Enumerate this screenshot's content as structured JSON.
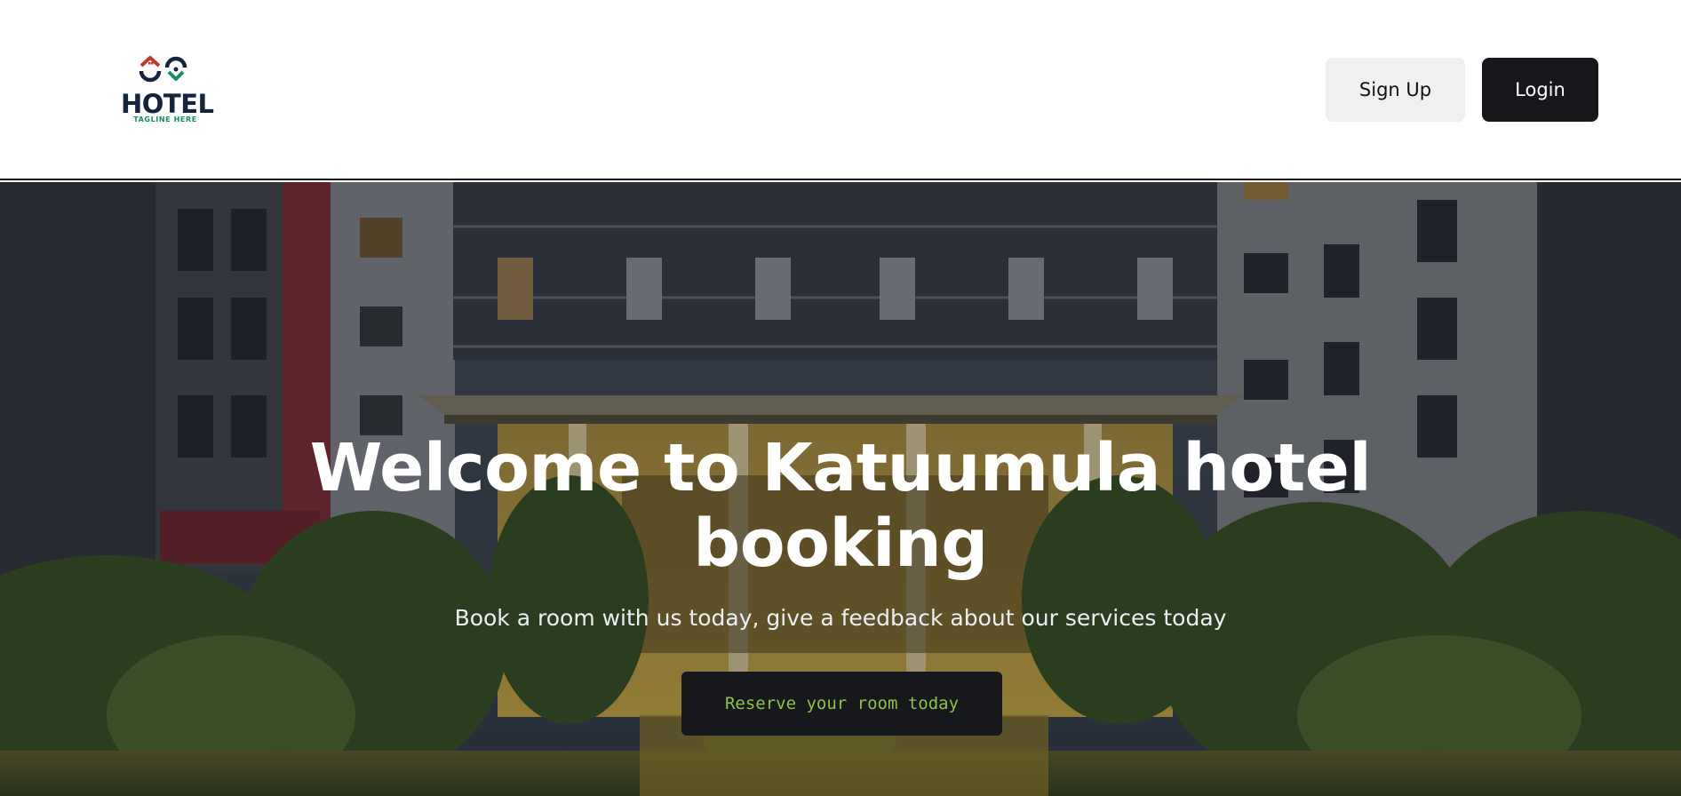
{
  "header": {
    "logo": {
      "word": "HOTEL",
      "tagline": "TAGLINE HERE",
      "icon": "hotel-logo-icon"
    },
    "signup_label": "Sign Up",
    "login_label": "Login"
  },
  "hero": {
    "title": "Welcome to Katuumula hotel booking",
    "subtitle": "Book a room with us today, give a feedback about our services today",
    "cta_label": "Reserve your room today",
    "background": "hotel-building-photo"
  },
  "colors": {
    "login_bg": "#16171a",
    "signup_bg": "#f0f0f0",
    "cta_bg": "#17181b",
    "cta_text": "#8bc34a",
    "logo_navy": "#15233f",
    "logo_green": "#1f8a63",
    "logo_red": "#c0392b"
  }
}
